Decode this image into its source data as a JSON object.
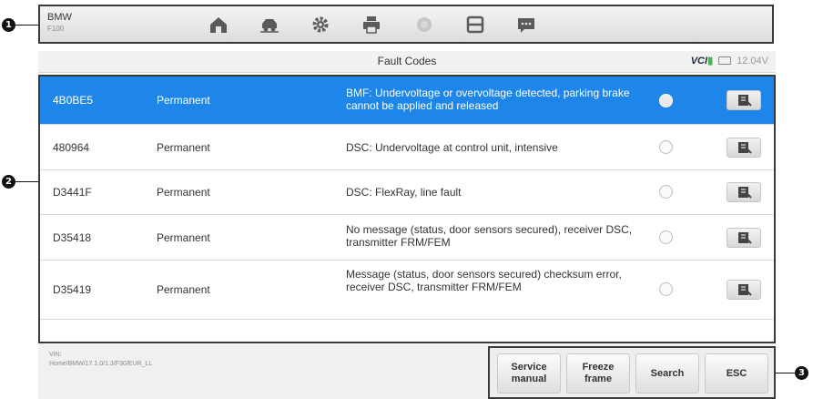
{
  "vehicle": {
    "make": "BMW",
    "model": "F100"
  },
  "toolbar": {
    "icons": [
      "home-icon",
      "vehicle-swap-icon",
      "settings-icon",
      "print-icon",
      "help-icon",
      "save-icon",
      "message-icon"
    ]
  },
  "header": {
    "title": "Fault Codes",
    "vci_label": "VCI",
    "voltage": "12.04V"
  },
  "faults": [
    {
      "code": "4B0BE5",
      "status": "Permanent",
      "description": "BMF: Undervoltage or overvoltage detected, parking brake cannot be applied and released",
      "selected": true
    },
    {
      "code": "480964",
      "status": "Permanent",
      "description": "DSC: Undervoltage at control unit, intensive",
      "selected": false
    },
    {
      "code": "D3441F",
      "status": "Permanent",
      "description": "DSC: FlexRay, line fault",
      "selected": false
    },
    {
      "code": "D35418",
      "status": "Permanent",
      "description": "No message (status, door sensors secured), receiver DSC, transmitter FRM/FEM",
      "selected": false
    },
    {
      "code": "D35419",
      "status": "Permanent",
      "description": "Message (status, door sensors secured) checksum error, receiver DSC, transmitter FRM/FEM",
      "selected": false
    }
  ],
  "footer": {
    "vin_label": "VIN:",
    "path": "Home/BMW/17.1.0/1.3/F30/EUR_LL",
    "buttons": {
      "service_manual": "Service\nmanual",
      "freeze_frame": "Freeze\nframe",
      "search": "Search",
      "esc": "ESC"
    }
  },
  "callouts": [
    "1",
    "2",
    "3"
  ],
  "colors": {
    "selected_row": "#1e86e8",
    "frame": "#3a3a3a"
  }
}
